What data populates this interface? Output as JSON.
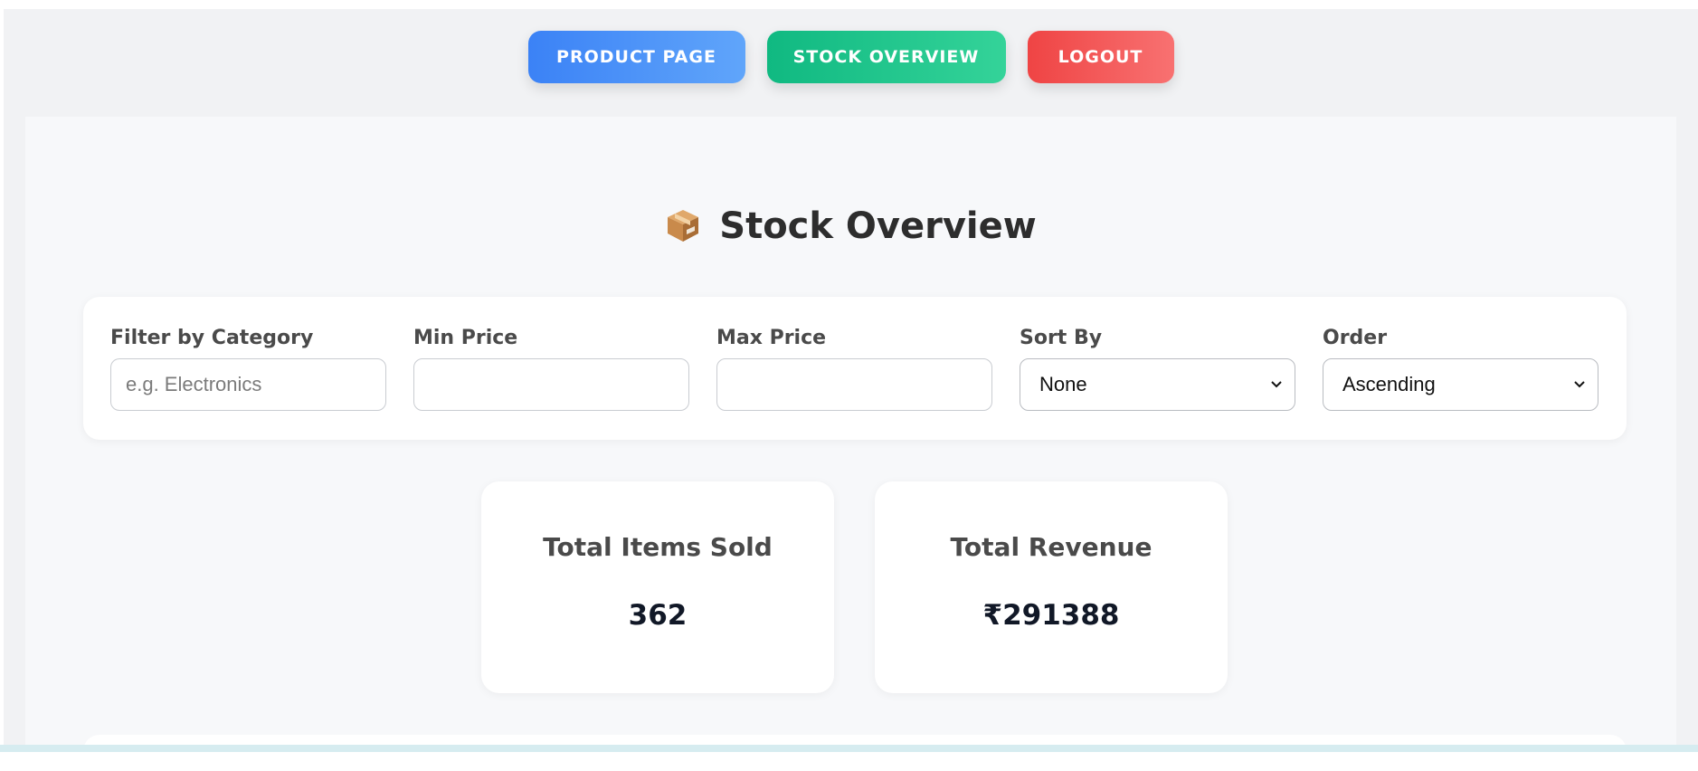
{
  "nav": {
    "product_label": "PRODUCT PAGE",
    "stock_label": "STOCK OVERVIEW",
    "logout_label": "LOGOUT"
  },
  "title": {
    "icon": "package-icon",
    "text": "Stock Overview"
  },
  "filters": {
    "category": {
      "label": "Filter by Category",
      "placeholder": "e.g. Electronics",
      "value": ""
    },
    "min_price": {
      "label": "Min Price",
      "placeholder": "",
      "value": ""
    },
    "max_price": {
      "label": "Max Price",
      "placeholder": "",
      "value": ""
    },
    "sort_by": {
      "label": "Sort By",
      "selected": "None"
    },
    "order": {
      "label": "Order",
      "selected": "Ascending"
    }
  },
  "stats": {
    "items_sold": {
      "label": "Total Items Sold",
      "value": "362"
    },
    "revenue": {
      "label": "Total Revenue",
      "value": "₹291388"
    }
  },
  "colors": {
    "product_btn": "#3b82f6",
    "stock_btn": "#10b981",
    "logout_btn": "#ef4444"
  }
}
